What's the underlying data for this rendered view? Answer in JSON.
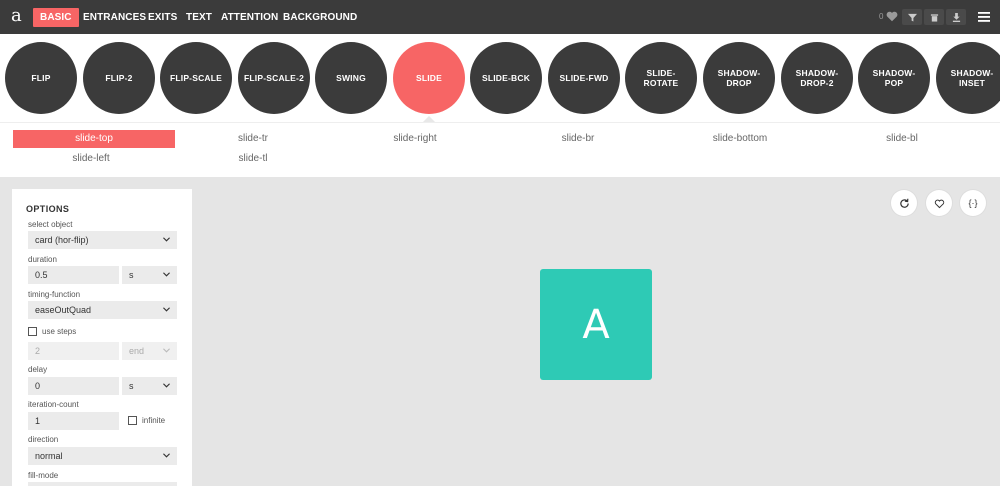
{
  "logo": "a",
  "nav": [
    "BASIC",
    "ENTRANCES",
    "EXITS",
    "TEXT",
    "ATTENTION",
    "BACKGROUND"
  ],
  "like_count": "0",
  "circles": [
    "FLIP",
    "FLIP-2",
    "FLIP-SCALE",
    "FLIP-SCALE-2",
    "SWING",
    "SLIDE",
    "SLIDE-BCK",
    "SLIDE-FWD",
    "SLIDE-ROTATE",
    "SHADOW-\nDROP",
    "SHADOW-\nDROP-2",
    "SHADOW-POP",
    "SHADOW-\nINSET"
  ],
  "variants": [
    "slide-top",
    "slide-tr",
    "slide-right",
    "slide-br",
    "slide-bottom",
    "slide-bl",
    "slide-left",
    "slide-tl"
  ],
  "options": {
    "title": "OPTIONS",
    "select_object_label": "select object",
    "select_object_value": "card (hor-flip)",
    "duration_label": "duration",
    "duration_value": "0.5",
    "duration_unit": "s",
    "timing_label": "timing-function",
    "timing_value": "easeOutQuad",
    "use_steps_label": "use steps",
    "steps_value": "2",
    "steps_dir": "end",
    "delay_label": "delay",
    "delay_value": "0",
    "delay_unit": "s",
    "iteration_label": "iteration-count",
    "iteration_value": "1",
    "infinite_label": "infinite",
    "direction_label": "direction",
    "direction_value": "normal",
    "fillmode_label": "fill-mode"
  },
  "preview": {
    "card_letter": "A",
    "code_label": "{·}"
  },
  "colors": {
    "accent": "#f76565",
    "dark": "#3b3b3b",
    "card": "#2ecab5"
  },
  "icons": [
    "heart-icon",
    "filter-icon",
    "trash-icon",
    "download-icon",
    "menu-icon",
    "refresh-icon",
    "chevron-down-icon"
  ]
}
